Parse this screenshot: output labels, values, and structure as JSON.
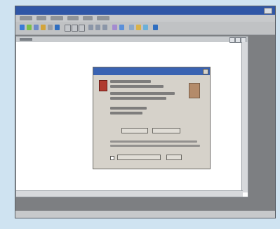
{
  "app": {
    "window_title": "",
    "menu_items": [
      "",
      "",
      "",
      "",
      "",
      ""
    ],
    "toolbar_icons": [
      "undo-icon",
      "redo-icon",
      "cut-icon",
      "copy-icon",
      "paste-icon",
      "print-icon",
      "bold-icon",
      "italic-icon",
      "underline-icon",
      "align-left-icon",
      "align-center-icon",
      "align-right-icon",
      "bullets-icon",
      "numbering-icon",
      "table-icon",
      "image-icon",
      "link-icon",
      "help-icon"
    ]
  },
  "document": {
    "title": ""
  },
  "dialog": {
    "title": "",
    "info_lines": [
      "",
      "",
      "",
      "",
      "",
      ""
    ],
    "buttons": {
      "left": "",
      "middle": "",
      "ok": ""
    },
    "checkbox_label": ""
  }
}
